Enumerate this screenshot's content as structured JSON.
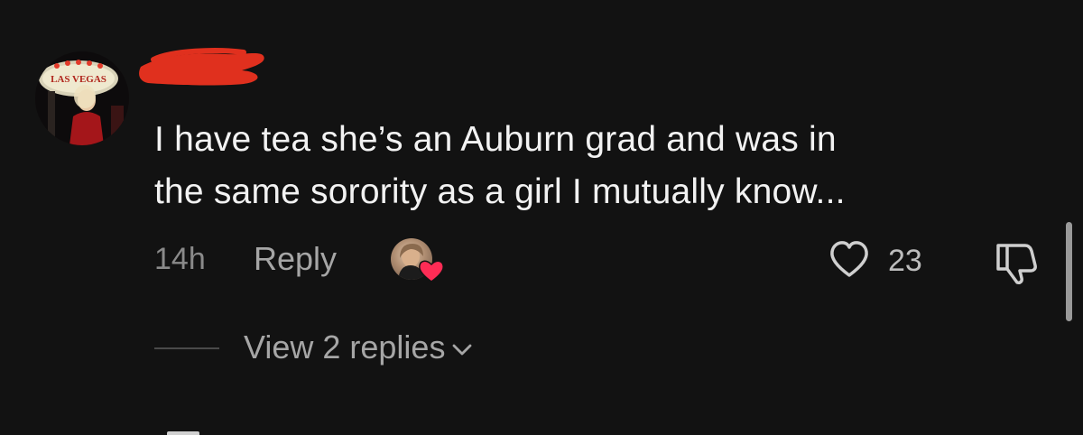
{
  "comment": {
    "avatar_icon": "user-avatar",
    "avatar_sign_text": "LAS VEGAS",
    "username_redacted": true,
    "text_lines": [
      "I have tea she’s an Auburn grad and was in",
      "the same sorority as a girl I mutually know..."
    ],
    "timestamp": "14h",
    "reply_label": "Reply",
    "creator_liked": true,
    "like_icon": "heart-outline-icon",
    "like_count": "23",
    "dislike_icon": "thumbs-down-icon",
    "view_replies_label": "View 2 replies",
    "view_replies_icon": "chevron-down-icon"
  },
  "colors": {
    "background": "#121212",
    "text": "#f2f2f2",
    "secondary_text": "#a6a6a6",
    "redaction": "#e0301e",
    "creator_heart": "#fe2c55"
  }
}
